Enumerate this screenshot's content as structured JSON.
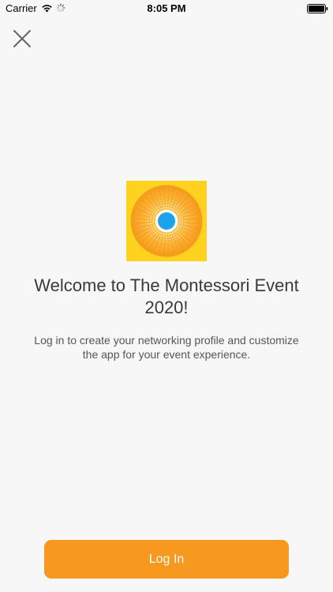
{
  "status_bar": {
    "carrier": "Carrier",
    "time": "8:05 PM",
    "icons": [
      "wifi-icon",
      "activity-spinner-icon",
      "battery-icon"
    ]
  },
  "header": {
    "close_icon": "close-icon"
  },
  "main": {
    "logo_icon": "sun-burst-logo-icon",
    "welcome_text": "Welcome to The Montessori Event 2020!",
    "subtitle": "Log in to create your networking profile and customize the app for your event experience."
  },
  "footer": {
    "login_label": "Log In"
  },
  "colors": {
    "accent": "#f7981f",
    "logo_background": "#ffd21f",
    "logo_center": "#1aa3e8",
    "background": "#f7f7f7"
  }
}
